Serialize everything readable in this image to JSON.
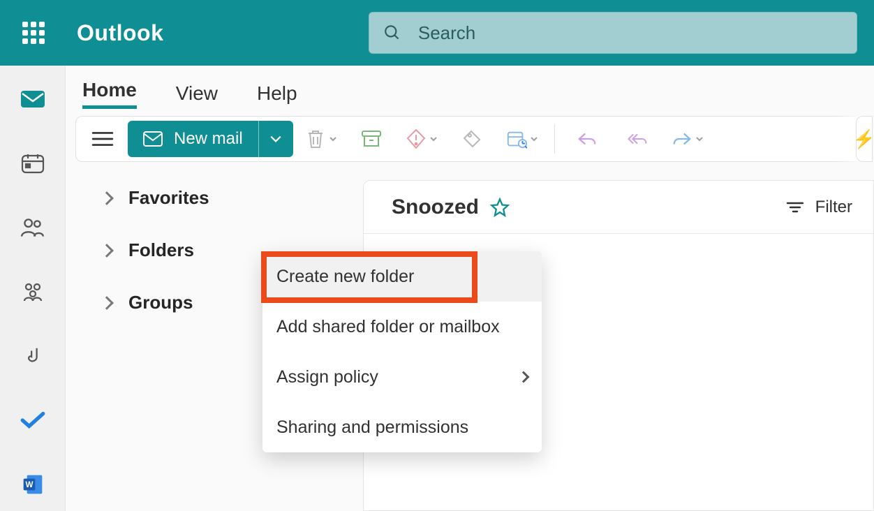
{
  "app_name": "Outlook",
  "search": {
    "placeholder": "Search"
  },
  "tabs": {
    "home": "Home",
    "view": "View",
    "help": "Help"
  },
  "toolbar": {
    "new_mail": "New mail"
  },
  "folders": {
    "favorites": "Favorites",
    "folders_label": "Folders",
    "groups": "Groups"
  },
  "pane": {
    "title": "Snoozed",
    "filter": "Filter"
  },
  "context_menu": {
    "create_folder": "Create new folder",
    "add_shared": "Add shared folder or mailbox",
    "assign_policy": "Assign policy",
    "sharing": "Sharing and permissions"
  }
}
